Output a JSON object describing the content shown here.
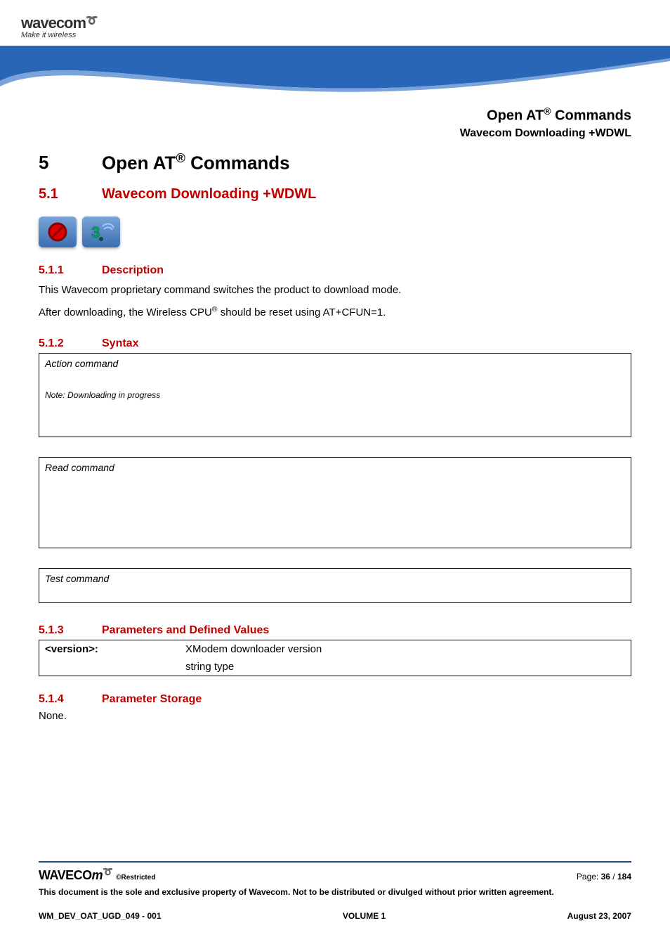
{
  "header": {
    "logo_brand": "wavecom",
    "logo_tagline": "Make it wireless",
    "top_right_main": "Open AT® Commands",
    "top_right_sub": "Wavecom Downloading +WDWL"
  },
  "chapter": {
    "number": "5",
    "title": "Open AT® Commands"
  },
  "section": {
    "number": "5.1",
    "title": "Wavecom Downloading +WDWL"
  },
  "icons": {
    "nosim": "no-sim-icon",
    "threeg": "3g-icon"
  },
  "subsections": {
    "description": {
      "number": "5.1.1",
      "title": "Description",
      "para1": "This Wavecom proprietary command switches the product to download mode.",
      "para2": "After downloading, the Wireless CPU® should be reset using AT+CFUN=1."
    },
    "syntax": {
      "number": "5.1.2",
      "title": "Syntax",
      "action_label": "Action command",
      "action_note": "Note: Downloading in progress",
      "read_label": "Read command",
      "test_label": "Test command"
    },
    "params": {
      "number": "5.1.3",
      "title": "Parameters and Defined Values",
      "rows": [
        {
          "name": "<version>:",
          "desc": "XModem downloader version"
        },
        {
          "name": "",
          "desc": "string type"
        }
      ]
    },
    "storage": {
      "number": "5.1.4",
      "title": "Parameter Storage",
      "body": "None."
    }
  },
  "footer": {
    "logo": "wavecom",
    "restricted": "©Restricted",
    "page_label": "Page: ",
    "page_current": "36",
    "page_sep": " / ",
    "page_total": "184",
    "legal": "This document is the sole and exclusive property of Wavecom. Not to be distributed or divulged without prior written agreement.",
    "doc_id": "WM_DEV_OAT_UGD_049 - 001",
    "volume": "VOLUME 1",
    "date": "August 23, 2007"
  }
}
